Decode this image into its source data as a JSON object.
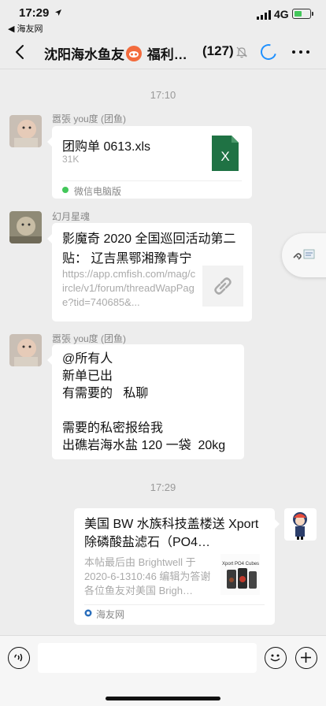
{
  "status_bar": {
    "time": "17:29",
    "back_app": "◀ 海友网",
    "network": "4G"
  },
  "nav": {
    "title_prefix": "沈阳海水鱼友",
    "title_suffix": "福利…",
    "member_count": "(127)"
  },
  "messages": {
    "time1": "17:10",
    "m1": {
      "sender": "嚣張 you度 (团鱼)",
      "file_name": "团购单 0613.xls",
      "file_size": "31K",
      "file_icon_letter": "X",
      "source": "微信电脑版"
    },
    "m2": {
      "sender": "幻月星魂",
      "title": "影魔奇 2020 全国巡回活动第二贴： 辽吉黑鄂湘豫青宁",
      "url": "https://app.cmfish.com/mag/circle/v1/forum/threadWapPage?tid=740685&..."
    },
    "m3": {
      "sender": "嚣張 you度 (团鱼)",
      "text": "@所有人\n新单已出\n有需要的   私聊\n\n需要的私密报给我\n出礁岩海水盐 120 一袋  20kg"
    },
    "time2": "17:29",
    "m4": {
      "title": "美国 BW 水族科技盖楼送 Xport 除磷酸盐滤石（PO4…",
      "desc": "本帖最后由 Brightwell 于 2020-6-1310:46 编辑为答谢各位鱼友对美国 Brigh…",
      "source": "海友网",
      "thumb_label": "Xport PO4 Cubes"
    }
  },
  "input": {
    "placeholder": ""
  },
  "colors": {
    "background": "#ededed",
    "accent_green": "#43c75a",
    "excel_green": "#1f7244",
    "link_blue": "#1e90ff"
  }
}
